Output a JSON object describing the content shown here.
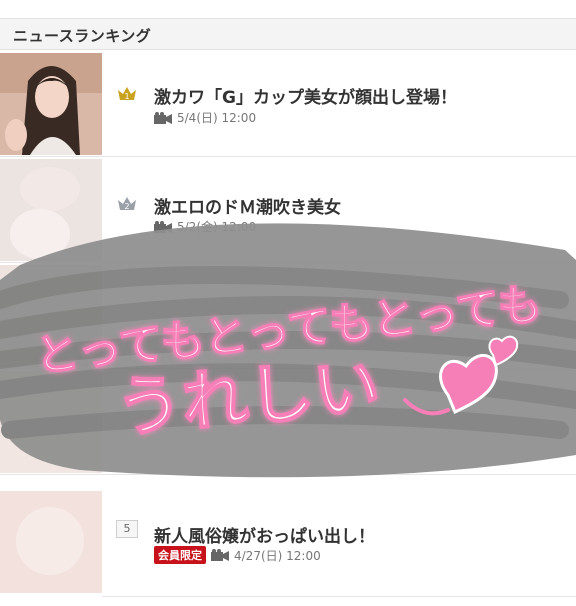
{
  "header": {
    "title": "ニュースランキング"
  },
  "items": [
    {
      "rank": "1",
      "title": "激カワ「G」カップ美女が顔出し登場！",
      "date": "5/4(日) 12:00",
      "badge": ""
    },
    {
      "rank": "2",
      "title": "激エロのドＭ潮吹き美女",
      "date": "5/2(金) 12:00",
      "badge": ""
    },
    {
      "rank": "5",
      "title": "新人風俗嬢がおっぱい出し！",
      "date": "4/27(日) 12:00",
      "badge": "会員限定"
    }
  ],
  "overlay": {
    "line1": "とってもとってもとっても",
    "line2": "うれしい"
  },
  "colors": {
    "accent_pink": "#f77fb8",
    "badge_red": "#c8121b",
    "gold": "#c9a320",
    "silver": "#9aa0a8"
  },
  "icons": {
    "crown": "crown-icon",
    "camera": "camera-icon"
  }
}
